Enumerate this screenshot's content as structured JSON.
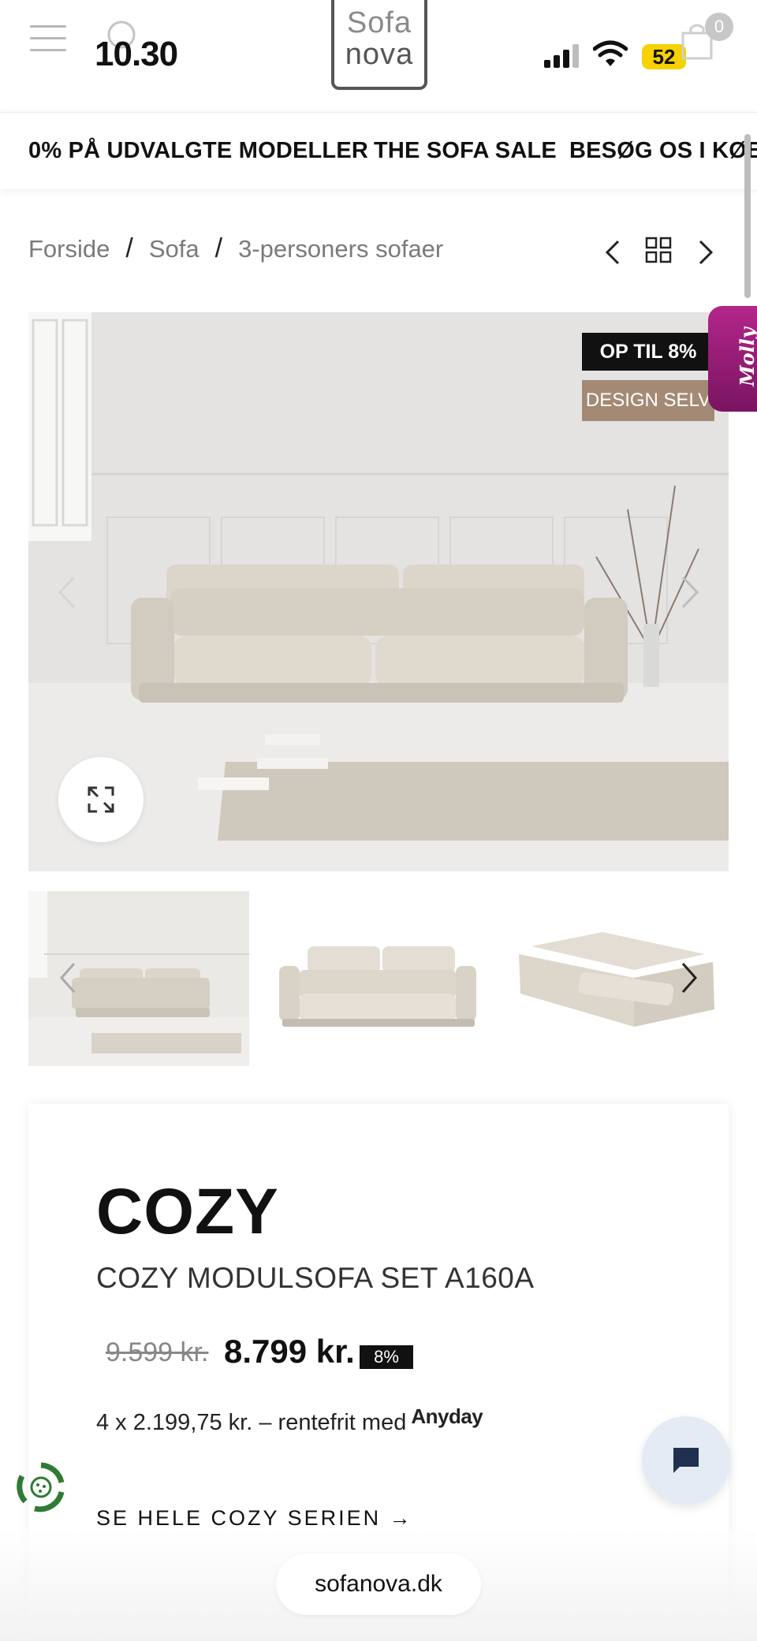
{
  "status_bar": {
    "time": "10.30",
    "battery": "52"
  },
  "header": {
    "logo_line1": "Sofa",
    "logo_line2": "nova",
    "cart_count": "0"
  },
  "promo_strip": {
    "items": [
      "0% PÅ UDVALGTE MODELLER",
      "THE SOFA SALE",
      "BESØG OS I KØBE"
    ]
  },
  "breadcrumb": {
    "items": [
      "Forside",
      "Sofa",
      "3-personers sofaer"
    ],
    "separator": "/"
  },
  "gallery": {
    "badge_discount": "OP TIL 8%",
    "badge_design": "DESIGN SELV",
    "chat_widget_label": "Molly"
  },
  "product": {
    "brand": "COZY",
    "name": "COZY MODULSOFA SET A160A",
    "old_price": "9.599 kr.",
    "new_price": "8.799 kr.",
    "discount": "8%",
    "installments_text": "4 x 2.199,75 kr. – rentefrit med",
    "installments_provider": "Anyday",
    "series_link": "SE HELE COZY SERIEN →"
  },
  "browser": {
    "url": "sofanova.dk"
  },
  "colors": {
    "accent_black": "#111111",
    "design_badge": "#a48a74",
    "molly": "#b3268a",
    "battery": "#f7d100"
  }
}
